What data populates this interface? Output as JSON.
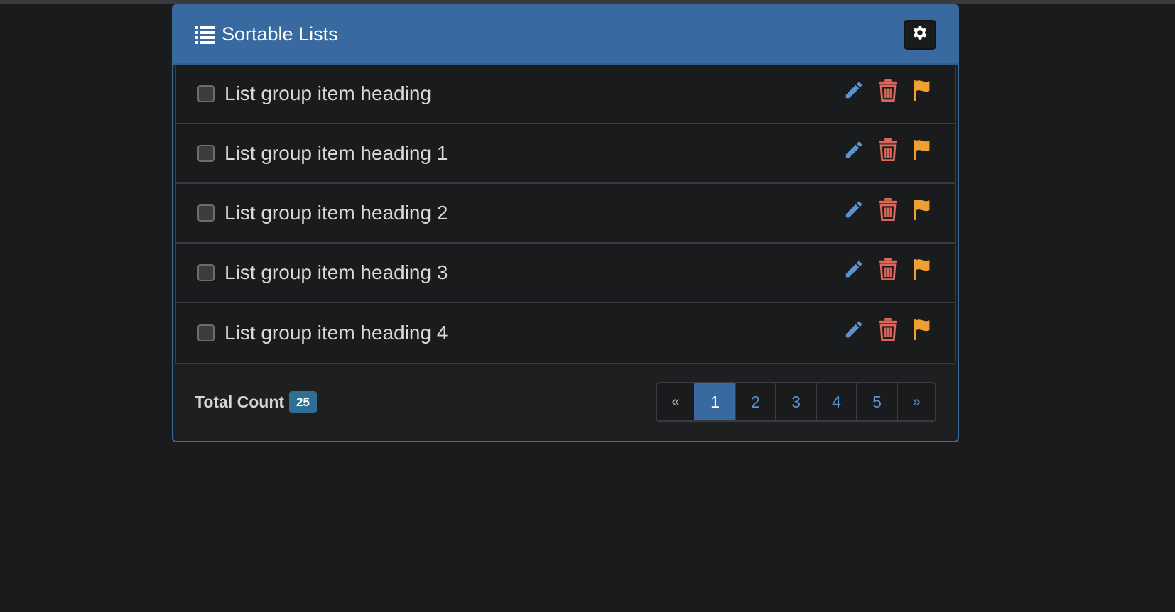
{
  "panel": {
    "title": "Sortable Lists",
    "header_icon": "list-icon",
    "settings_icon": "gear-icon"
  },
  "list": {
    "items": [
      {
        "label": "List group item heading"
      },
      {
        "label": "List group item heading 1"
      },
      {
        "label": "List group item heading 2"
      },
      {
        "label": "List group item heading 3"
      },
      {
        "label": "List group item heading 4"
      }
    ],
    "action_icons": [
      "pencil-icon",
      "trash-icon",
      "flag-icon"
    ]
  },
  "footer": {
    "total_label": "Total Count",
    "total_count": "25"
  },
  "pagination": {
    "prev": "«",
    "pages": [
      "1",
      "2",
      "3",
      "4",
      "5"
    ],
    "active_page": "1",
    "next": "»"
  },
  "colors": {
    "header_bg": "#386aa0",
    "edit": "#5b93cf",
    "delete": "#d9675a",
    "flag": "#f0a030",
    "badge": "#2f6f94"
  }
}
